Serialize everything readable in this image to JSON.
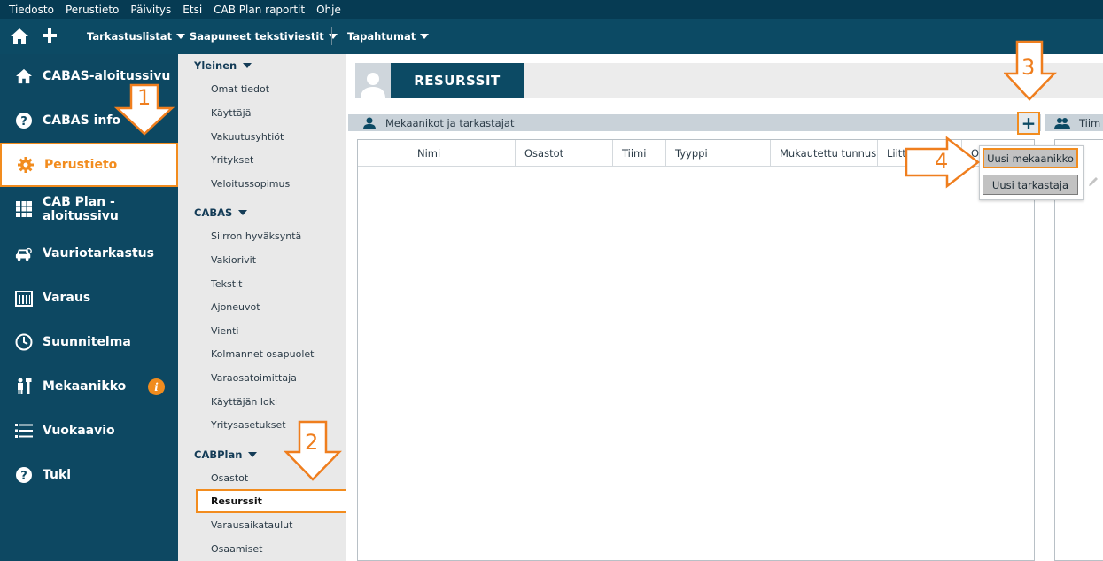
{
  "menubar": [
    "Tiedosto",
    "Perustieto",
    "Päivitys",
    "Etsi",
    "CAB Plan raportit",
    "Ohje"
  ],
  "toolbar": {
    "home_icon": "home-icon",
    "add_icon": "plus-icon",
    "menus": [
      "Tarkastuslistat",
      "Saapuneet tekstiviestit",
      "Tapahtumat"
    ]
  },
  "leftnav": [
    {
      "label": "CABAS-aloitussivu",
      "icon": "home-icon"
    },
    {
      "label": "CABAS info",
      "icon": "question-icon"
    },
    {
      "label": "Perustieto",
      "icon": "gear-icon",
      "active": true
    },
    {
      "label": "CAB Plan -aloitussivu",
      "icon": "grid-icon"
    },
    {
      "label": "Vauriotarkastus",
      "icon": "car-damage-icon"
    },
    {
      "label": "Varaus",
      "icon": "calendar-icon"
    },
    {
      "label": "Suunnitelma",
      "icon": "clock-icon"
    },
    {
      "label": "Mekaanikko",
      "icon": "mechanic-icon",
      "badge": "i"
    },
    {
      "label": "Vuokaavio",
      "icon": "list-icon"
    },
    {
      "label": "Tuki",
      "icon": "help-icon"
    }
  ],
  "subnav": {
    "sections": [
      {
        "title": "Yleinen",
        "items": [
          "Omat tiedot",
          "Käyttäjä",
          "Vakuutusyhtiöt",
          "Yritykset",
          "Veloitussopimus"
        ]
      },
      {
        "title": "CABAS",
        "items": [
          "Siirron hyväksyntä",
          "Vakiorivit",
          "Tekstit",
          "Ajoneuvot",
          "Vienti",
          "Kolmannet osapuolet",
          "Varaosatoimittaja",
          "Käyttäjän loki",
          "Yritysasetukset"
        ]
      },
      {
        "title": "CABPlan",
        "items": [
          "Osastot",
          "Resurssit",
          "Varausaikataulut",
          "Osaamiset"
        ]
      }
    ],
    "active_item": "Resurssit"
  },
  "content": {
    "title": "RESURSSIT",
    "panel_title": "Mekaanikot ja tarkastajat",
    "add_button": "+",
    "panel2_title": "Tiim",
    "columns": [
      "Nimi",
      "Osastot",
      "Tiimi",
      "Tyyppi",
      "Mukautettu tunnus",
      "Liitty",
      "O"
    ],
    "dropdown": [
      "Uusi mekaanikko",
      "Uusi tarkastaja"
    ]
  },
  "annotations": [
    "1",
    "2",
    "3",
    "4"
  ],
  "colors": {
    "accent": "#f28c1e",
    "nav_bg": "#0d4862",
    "menubar_bg": "#063b53"
  }
}
